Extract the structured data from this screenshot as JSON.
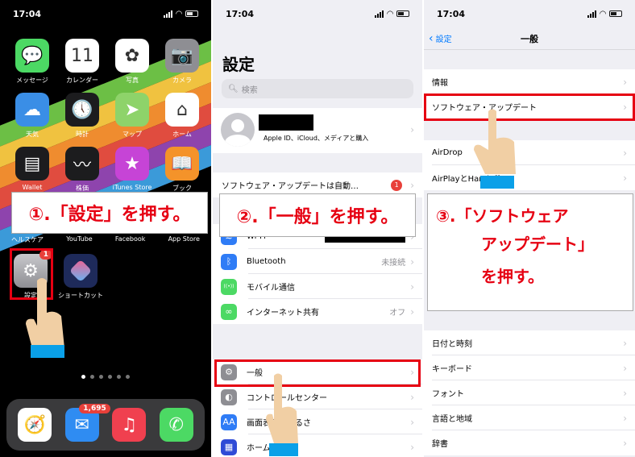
{
  "status_bar": {
    "time": "17:04"
  },
  "panel1": {
    "apps": [
      {
        "label": "メッセージ",
        "icon": "messages-icon",
        "glyph": "💬",
        "color": "#4cd964"
      },
      {
        "label": "カレンダー",
        "icon": "calendar-icon",
        "glyph": "11",
        "day": "日",
        "color": "#ffffff"
      },
      {
        "label": "写真",
        "icon": "photos-icon",
        "glyph": "✿",
        "color": "#ffffff"
      },
      {
        "label": "カメラ",
        "icon": "camera-icon",
        "glyph": "📷",
        "color": "#8e8e93"
      },
      {
        "label": "天気",
        "icon": "weather-icon",
        "glyph": "☁",
        "color": "#3a8ee6"
      },
      {
        "label": "時計",
        "icon": "clock-icon",
        "glyph": "🕔",
        "color": "#1c1c1e"
      },
      {
        "label": "マップ",
        "icon": "maps-icon",
        "glyph": "➤",
        "color": "#8ed36a"
      },
      {
        "label": "ホーム",
        "icon": "home-icon",
        "glyph": "⌂",
        "color": "#ffffff"
      },
      {
        "label": "Wallet",
        "icon": "wallet-icon",
        "glyph": "▤",
        "color": "#1c1c1e"
      },
      {
        "label": "株価",
        "icon": "stocks-icon",
        "glyph": "〰",
        "color": "#1c1c1e"
      },
      {
        "label": "iTunes Store",
        "icon": "itunes-store-icon",
        "glyph": "★",
        "color": "#c644d6"
      },
      {
        "label": "ブック",
        "icon": "books-icon",
        "glyph": "📖",
        "color": "#f4932a"
      }
    ],
    "hidden_row_labels": [
      "ヘルスケア",
      "YouTube",
      "Facebook",
      "App Store"
    ],
    "settings_app": {
      "label": "設定",
      "badge": "1"
    },
    "shortcuts_app": {
      "label": "ショートカット"
    },
    "callout": "①.「設定」を押す。",
    "page_dots": 6,
    "active_dot": 0,
    "dock": [
      {
        "icon": "safari-icon",
        "glyph": "🧭",
        "color": "#ffffff"
      },
      {
        "icon": "mail-icon",
        "glyph": "✉",
        "color": "#2f8cf2",
        "badge": "1,695"
      },
      {
        "icon": "music-icon",
        "glyph": "♫",
        "color": "#f0404f"
      },
      {
        "icon": "phone-icon",
        "glyph": "✆",
        "color": "#4cd964"
      }
    ],
    "stripe_colors": [
      "#6cbf45",
      "#f0c240",
      "#ef8c2f",
      "#e04c3f",
      "#8e44ad",
      "#3b9ad9"
    ]
  },
  "panel2": {
    "title": "設定",
    "search_placeholder": "検索",
    "profile_subtitle": "Apple ID、iCloud、メディアと購入",
    "update_row": {
      "label": "ソフトウェア・アップデートは自動…",
      "badge": "1"
    },
    "callout": "②.「一般」を押す。",
    "network_rows": [
      {
        "label": "Wi-Fi",
        "value": "",
        "icon": "wifi-icon",
        "glyph": "≋",
        "color": "#2f7cf6",
        "redacted": true
      },
      {
        "label": "Bluetooth",
        "value": "未接続",
        "icon": "bluetooth-icon",
        "glyph": "ᛒ",
        "color": "#2f7cf6"
      },
      {
        "label": "モバイル通信",
        "value": "",
        "icon": "cellular-icon",
        "glyph": "((•))",
        "color": "#4cd964"
      },
      {
        "label": "インターネット共有",
        "value": "オフ",
        "icon": "hotspot-icon",
        "glyph": "∞",
        "color": "#4cd964"
      }
    ],
    "general_rows": [
      {
        "label": "一般",
        "icon": "gear-icon",
        "glyph": "⚙",
        "color": "#8e8e93"
      },
      {
        "label": "コントロールセンター",
        "icon": "control-center-icon",
        "glyph": "◐",
        "color": "#8e8e93"
      },
      {
        "label": "画面表示と明るさ",
        "icon": "display-icon",
        "glyph": "AA",
        "color": "#2f7cf6"
      },
      {
        "label": "ホーム画面",
        "icon": "home-screen-icon",
        "glyph": "▦",
        "color": "#2f4bd6"
      }
    ]
  },
  "panel3": {
    "back_label": "設定",
    "title": "一般",
    "group1": [
      {
        "label": "情報"
      },
      {
        "label": "ソフトウェア・アップデート"
      }
    ],
    "group2": [
      {
        "label": "AirDrop"
      },
      {
        "label": "AirPlayとHandoff"
      }
    ],
    "callout_lines": [
      "③.「ソフトウェア",
      "アップデート」",
      "を押す。"
    ],
    "group3": [
      {
        "label": "日付と時刻"
      },
      {
        "label": "キーボード"
      },
      {
        "label": "フォント"
      },
      {
        "label": "言語と地域"
      },
      {
        "label": "辞書"
      }
    ]
  },
  "colors": {
    "highlight_red": "#e60012",
    "ios_blue": "#007aff",
    "cuff_blue": "#0aa0e8",
    "skin": "#f1cfa4"
  }
}
